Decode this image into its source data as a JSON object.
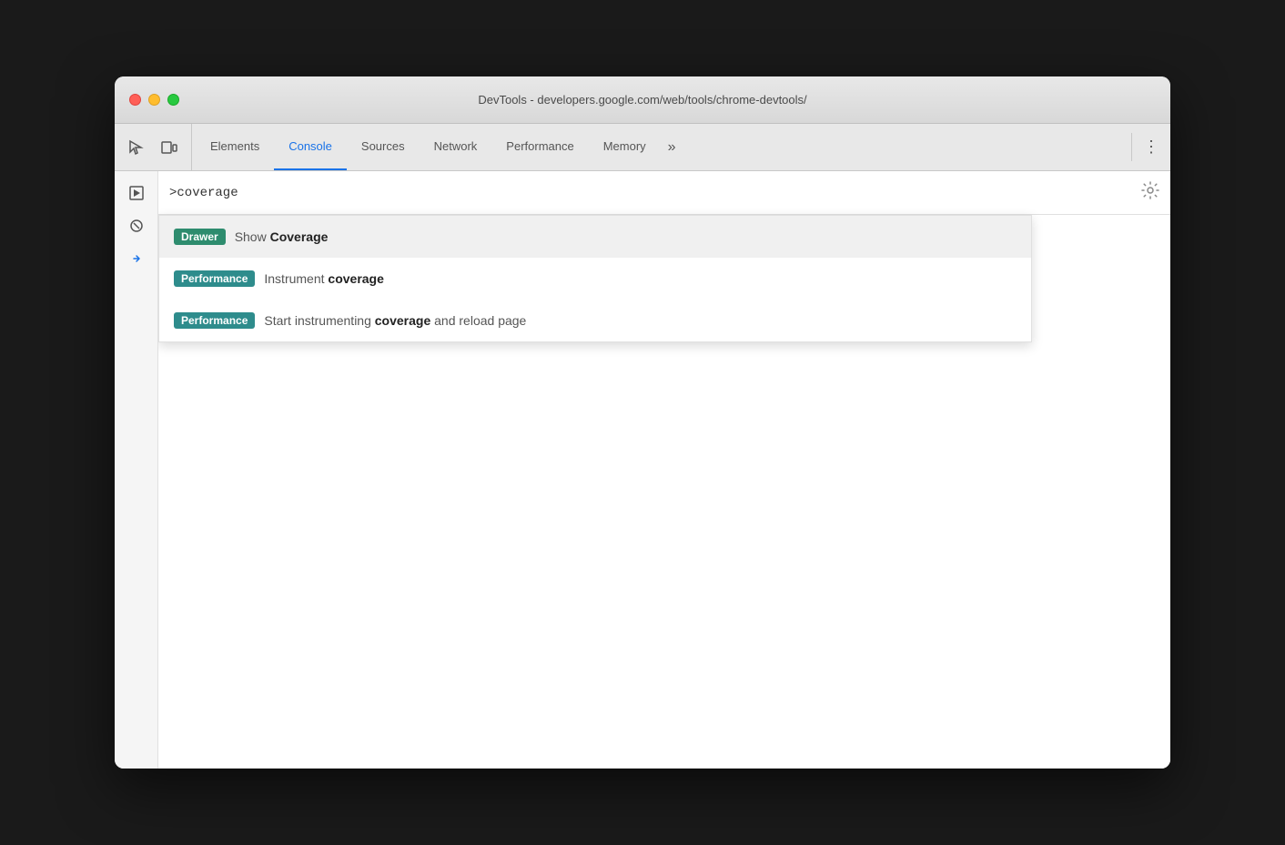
{
  "window": {
    "title": "DevTools - developers.google.com/web/tools/chrome-devtools/"
  },
  "traffic_lights": {
    "close": "close",
    "minimize": "minimize",
    "maximize": "maximize"
  },
  "tabs": [
    {
      "id": "elements",
      "label": "Elements",
      "active": false
    },
    {
      "id": "console",
      "label": "Console",
      "active": true
    },
    {
      "id": "sources",
      "label": "Sources",
      "active": false
    },
    {
      "id": "network",
      "label": "Network",
      "active": false
    },
    {
      "id": "performance",
      "label": "Performance",
      "active": false
    },
    {
      "id": "memory",
      "label": "Memory",
      "active": false
    }
  ],
  "tab_overflow_label": "»",
  "settings_icon": "⚙",
  "console_input": ">coverage",
  "autocomplete": {
    "items": [
      {
        "id": "show-coverage",
        "badge": "Drawer",
        "badge_type": "drawer",
        "text_before": "Show ",
        "text_highlight": "Coverage",
        "text_after": "",
        "highlighted": true
      },
      {
        "id": "instrument-coverage",
        "badge": "Performance",
        "badge_type": "performance",
        "text_before": "Instrument ",
        "text_highlight": "coverage",
        "text_after": "",
        "highlighted": false
      },
      {
        "id": "start-instrumenting",
        "badge": "Performance",
        "badge_type": "performance",
        "text_before": "Start instrumenting ",
        "text_highlight": "coverage",
        "text_after": " and reload page",
        "highlighted": false
      }
    ]
  },
  "sidebar": {
    "chevron_icon": "›",
    "play_icon": "▶",
    "filter_icon": "⊘"
  }
}
